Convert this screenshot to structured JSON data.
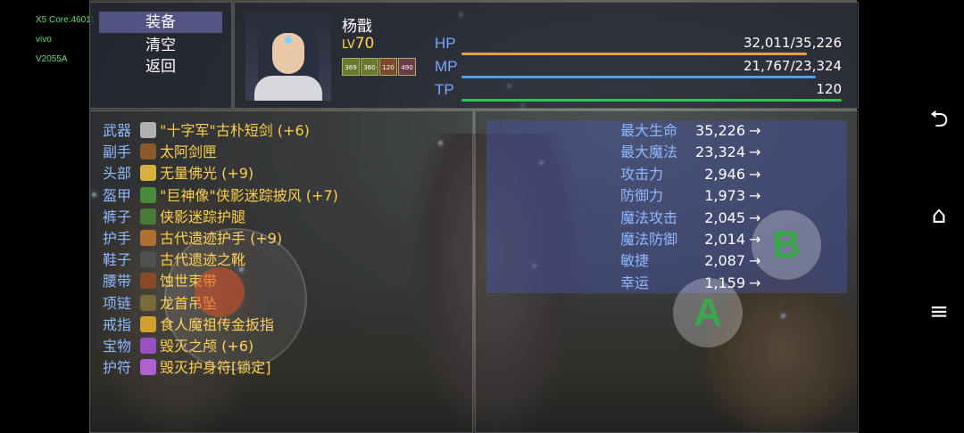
{
  "system": {
    "core": "X5 Core:46011",
    "brand": "vivo",
    "model": "V2055A"
  },
  "menu": {
    "items": [
      "装备",
      "清空",
      "返回"
    ],
    "selected": 0
  },
  "character": {
    "name": "杨戬",
    "level_prefix": "LV",
    "level": "70",
    "buffs": [
      "369",
      "360",
      "120",
      "490"
    ],
    "hp": {
      "label": "HP",
      "value": "32,011/35,226",
      "fraction": 0.909,
      "color": "#e6a040"
    },
    "mp": {
      "label": "MP",
      "value": "21,767/23,324",
      "fraction": 0.933,
      "color": "#4aa0ff"
    },
    "tp": {
      "label": "TP",
      "value": "120",
      "fraction": 1.0,
      "color": "#38c060"
    }
  },
  "equipment": [
    {
      "slot": "武器",
      "name": "\"十字军\"古朴短剑 (+6)",
      "icon": "sword-icon",
      "color": "#b0b0b0"
    },
    {
      "slot": "副手",
      "name": "太阿剑匣",
      "icon": "box-icon",
      "color": "#8a5a2a"
    },
    {
      "slot": "头部",
      "name": "无量佛光 (+9)",
      "icon": "halo-icon",
      "color": "#d8b040"
    },
    {
      "slot": "盔甲",
      "name": "\"巨神像\"侠影迷踪披风 (+7)",
      "icon": "cloak-icon",
      "color": "#4a8a3a"
    },
    {
      "slot": "裤子",
      "name": "侠影迷踪护腿",
      "icon": "legs-icon",
      "color": "#4a7a3a"
    },
    {
      "slot": "护手",
      "name": "古代遗迹护手 (+9)",
      "icon": "gauntlet-icon",
      "color": "#b07030"
    },
    {
      "slot": "鞋子",
      "name": "古代遗迹之靴",
      "icon": "boots-icon",
      "color": "#505050"
    },
    {
      "slot": "腰带",
      "name": "蚀世束带",
      "icon": "belt-icon",
      "color": "#8a4a2a"
    },
    {
      "slot": "项链",
      "name": "龙首吊坠",
      "icon": "necklace-icon",
      "color": "#7a6a3a"
    },
    {
      "slot": "戒指",
      "name": "食人魔祖传金扳指",
      "icon": "ring-icon",
      "color": "#d0a030"
    },
    {
      "slot": "宝物",
      "name": "毁灭之颅 (+6)",
      "icon": "skull-icon",
      "color": "#9a50c0"
    },
    {
      "slot": "护符",
      "name": "毁灭护身符[锁定]",
      "icon": "amulet-icon",
      "color": "#b060d0"
    }
  ],
  "stats": [
    {
      "name": "最大生命",
      "value": "35,226"
    },
    {
      "name": "最大魔法",
      "value": "23,324"
    },
    {
      "name": "攻击力",
      "value": "2,946"
    },
    {
      "name": "防御力",
      "value": "1,973"
    },
    {
      "name": "魔法攻击",
      "value": "2,045"
    },
    {
      "name": "魔法防御",
      "value": "2,014"
    },
    {
      "name": "敏捷",
      "value": "2,087"
    },
    {
      "name": "幸运",
      "value": "1,159"
    }
  ],
  "arrow": "→",
  "buttons": {
    "b": "B",
    "a": "A"
  },
  "nav": {
    "back": "⮌",
    "home": "⌂",
    "menu": "≡"
  }
}
